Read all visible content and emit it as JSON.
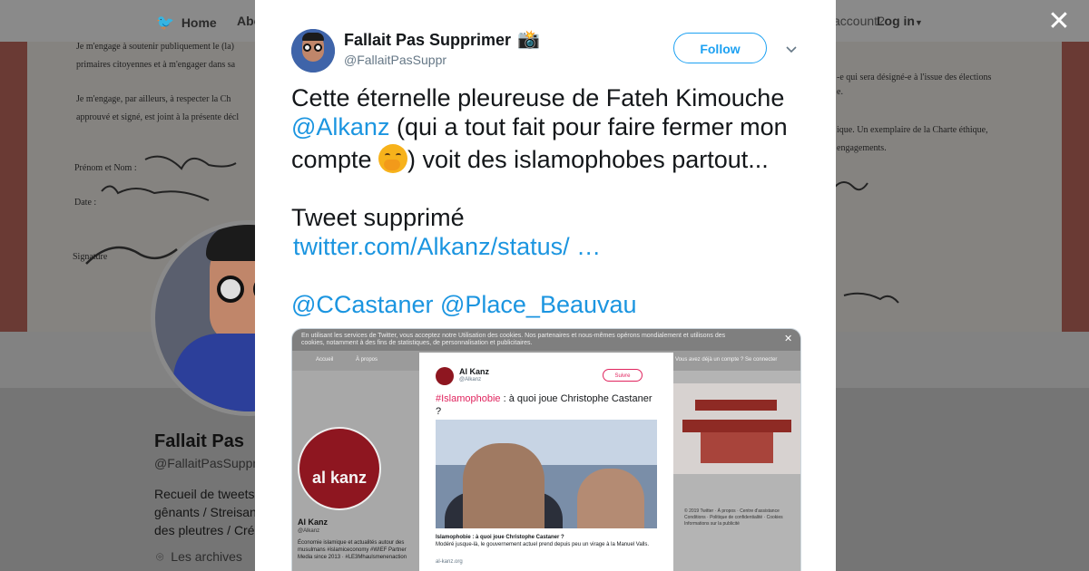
{
  "background": {
    "nav": {
      "home_label": "Home",
      "about_label": "Abo",
      "account_prompt": "account?",
      "login_label": "Log in"
    },
    "banner_document_lines": [
      "Je m'engage à soutenir publiquement le (la)",
      "primaires citoyennes et à m'engager dans sa",
      "Je m'engage, par ailleurs, à respecter la Ch",
      "approuvé et signé, est joint à la présente décl",
      "Prénom et Nom :",
      "Date :",
      "Signature",
      "-e qui sera désigné-e à l'issue des élections",
      "e.",
      "ique. Un exemplaire de la Charte éthique,",
      "engagements."
    ],
    "profile": {
      "name": "Fallait Pas",
      "handle": "@FallaitPasSuppr",
      "bio": "Recueil de tweets gênants / Streisan des pleutres / Cré",
      "location": "Les archives"
    }
  },
  "modal": {
    "author": {
      "name": "Fallait Pas Supprimer",
      "name_emoji": "📸",
      "handle": "@FallaitPasSuppr"
    },
    "follow_label": "Follow",
    "tweet": {
      "line1": "Cette éternelle pleureuse de Fateh Kimouche",
      "mention_alkanz": "@Alkanz",
      "line2_rest": " (qui a tout fait pour faire fermer mon",
      "line3_start": "compte ",
      "line3_end": ") voit des islamophobes partout...",
      "line4": "Tweet supprimé",
      "link": "twitter.com/Alkanz/status/ …",
      "mention_castaner": "@CCastaner",
      "mention_beauvau": "@Place_Beauvau"
    },
    "embedded_screenshot": {
      "cookie_notice": "En utilisant les services de Twitter, vous acceptez notre Utilisation des cookies. Nos partenaires et nous-mêmes opérons mondialement et utilisons des cookies, notamment à des fins de statistiques, de personnalisation et publicitaires.",
      "nav_home": "Accueil",
      "nav_about": "À propos",
      "nav_login": "Vous avez déjà un compte ? Se connecter",
      "profile_name": "Al Kanz",
      "profile_handle": "@Alkanz",
      "profile_logo_text": "al kanz",
      "profile_bio": "Économie islamique et actualités autour des musulmans #islamiceconomy #WIEF Partner Media since 2013 · #LE3Mhaulsmenenaction",
      "footer": "© 2019 Twitter · À propos · Centre d'assistance Conditions · Politique de confidentialité · Cookies Informations sur la publicité",
      "card": {
        "name": "Al Kanz",
        "handle": "@Alkanz",
        "follow": "Suivre",
        "hashtag": "#Islamophobie",
        "text": " : à quoi joue Christophe Castaner ?",
        "caption_title": "Islamophobie : à quoi joue Christophe Castaner ?",
        "caption_body": "Modéré jusque-là, le gouvernement actuel prend depuis peu un virage à la Manuel Valls.",
        "url": "al-kanz.org"
      }
    }
  }
}
